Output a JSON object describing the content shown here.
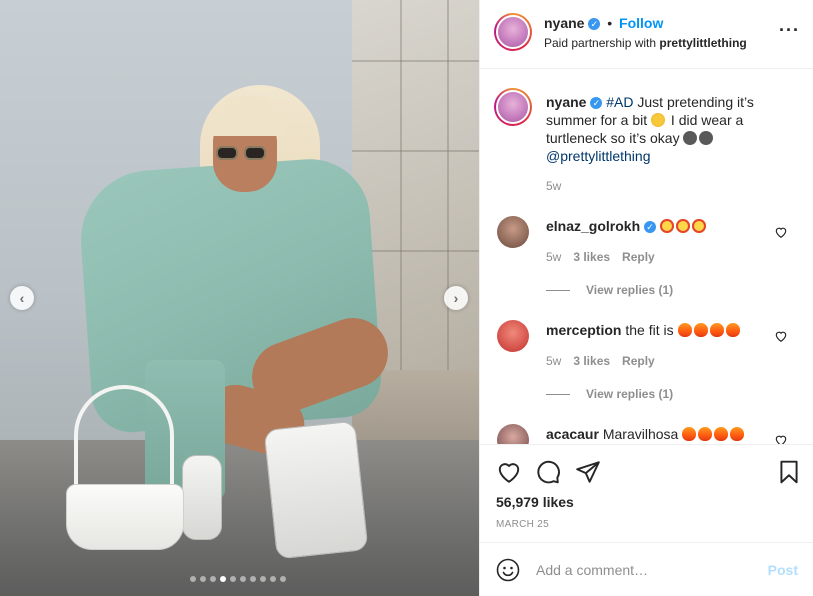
{
  "post": {
    "carousel_count": 10,
    "carousel_active_index": 3
  },
  "header": {
    "username": "nyane",
    "separator": "•",
    "follow_label": "Follow",
    "subtitle_prefix": "Paid partnership with ",
    "subtitle_partner": "prettylittlething",
    "more_icon": "more-horizontal-icon"
  },
  "caption": {
    "username": "nyane",
    "hashtag": "#AD",
    "text_part1": " Just pretending it’s summer for a bit ",
    "text_part2": " I did wear a turtleneck so it’s okay ",
    "mention": "@prettylittlething",
    "time": "5w"
  },
  "comments": [
    {
      "username": "elnaz_golrokh",
      "text": "",
      "emojis": [
        "heart-eyes",
        "heart-eyes",
        "heart-eyes"
      ],
      "time": "5w",
      "likes": "3 likes",
      "reply": "Reply",
      "view_replies": "View replies (1)",
      "avatar_color": "#8a6a5a"
    },
    {
      "username": "merception",
      "text": "the fit is ",
      "emojis": [
        "fire",
        "fire",
        "fire",
        "fire"
      ],
      "time": "5w",
      "likes": "3 likes",
      "reply": "Reply",
      "view_replies": "View replies (1)",
      "avatar_color": "#d14a4a"
    },
    {
      "username": "acacaur",
      "text": "Maravilhosa ",
      "emojis": [
        "fire",
        "fire",
        "fire",
        "fire"
      ],
      "avatar_color": "#9b6b6b"
    }
  ],
  "actions": {
    "likes": "56,979 likes",
    "date": "MARCH 25"
  },
  "add_comment": {
    "placeholder": "Add a comment…",
    "post_label": "Post"
  },
  "colors": {
    "link": "#00376b",
    "follow": "#0095f6",
    "muted": "#8e8e8e",
    "post_disabled": "#b2dffc"
  }
}
